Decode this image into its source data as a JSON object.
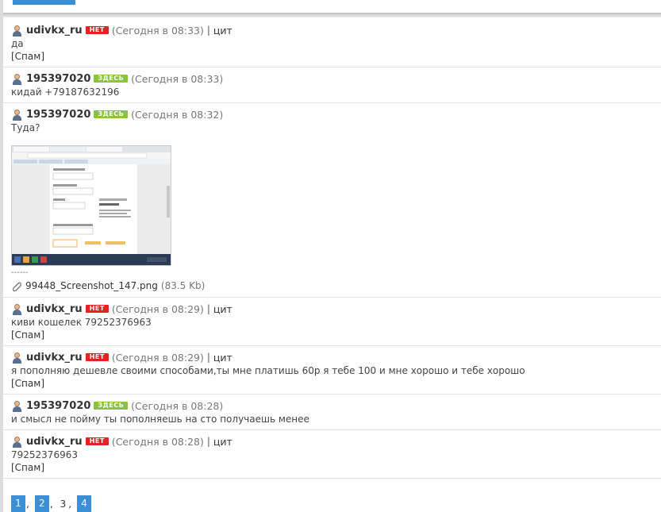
{
  "posts": [
    {
      "author": "udivkx_ru",
      "status": "НЕТ",
      "time": "(Сегодня в 08:33)",
      "sep": "|",
      "quote": "цит",
      "text": "да",
      "spam": "[Спам]"
    },
    {
      "author": "195397020",
      "status": "ЗДЕСЬ",
      "time": "(Сегодня в 08:33)",
      "text": "кидай +79187632196"
    },
    {
      "author": "195397020",
      "status": "ЗДЕСЬ",
      "time": "(Сегодня в 08:32)",
      "text": "Туда?",
      "dashes": "------",
      "file_name": "99448_Screenshot_147.png",
      "file_size": "(83.5 Kb)"
    },
    {
      "author": "udivkx_ru",
      "status": "НЕТ",
      "time": "(Сегодня в 08:29)",
      "sep": "|",
      "quote": "цит",
      "text": "киви кошелек 79252376963",
      "spam": "[Спам]"
    },
    {
      "author": "udivkx_ru",
      "status": "НЕТ",
      "time": "(Сегодня в 08:29)",
      "sep": "|",
      "quote": "цит",
      "text": "я пополняю дешевле своими способами,ты мне платишь 60р я тебе 100 и мне хорошо и тебе хорошо",
      "spam": "[Спам]"
    },
    {
      "author": "195397020",
      "status": "ЗДЕСЬ",
      "time": "(Сегодня в 08:28)",
      "text": "и смысл не пойму ты пополняешь на сто получаешь менее"
    },
    {
      "author": "udivkx_ru",
      "status": "НЕТ",
      "time": "(Сегодня в 08:28)",
      "sep": "|",
      "quote": "цит",
      "text": "79252376963",
      "spam": "[Спам]"
    }
  ],
  "pagination": {
    "pages": [
      "1",
      "2",
      "3",
      "4"
    ],
    "current": "3",
    "comma": ","
  },
  "colors": {
    "offline_badge": "#e52222",
    "online_badge": "#8ac43f",
    "page_link": "#3a8fd6"
  },
  "icons": {
    "avatar": "user-avatar-icon",
    "attachment": "paperclip-icon"
  }
}
